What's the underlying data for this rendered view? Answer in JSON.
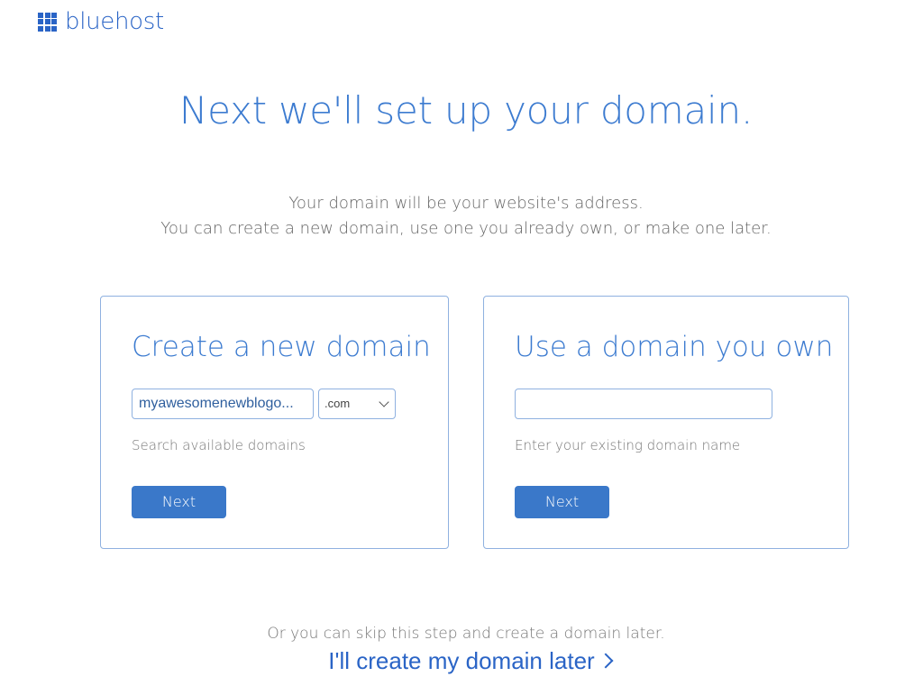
{
  "brand": {
    "name": "bluehost",
    "color": "#2a64c6"
  },
  "headline": "Next we'll set up your domain.",
  "subtitle": {
    "line1": "Your domain will be your website's address.",
    "line2": "You can create a new domain, use one you already own, or make one later."
  },
  "new_domain": {
    "title": "Create a new domain",
    "input_value": "myawesomenewblogo...",
    "tld_selected": ".com",
    "help": "Search available domains",
    "next_label": "Next"
  },
  "own_domain": {
    "title": "Use a domain you own",
    "input_value": "",
    "help": "Enter your existing domain name",
    "next_label": "Next"
  },
  "skip": {
    "text": "Or you can skip this step and create a domain later.",
    "link_label": "I'll create my domain later"
  },
  "colors": {
    "accent": "#3c7bd0",
    "button": "#3a78c9",
    "border": "#8fb1e0"
  }
}
